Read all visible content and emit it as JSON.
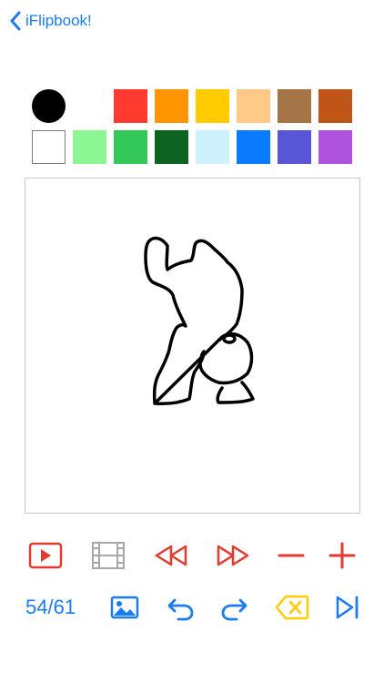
{
  "nav": {
    "back_label": "iFlipbook!"
  },
  "palette": {
    "row1": [
      {
        "name": "black",
        "hex": "#000000",
        "shape": "circle"
      },
      {
        "name": "white",
        "hex": "#ffffff",
        "shape": "square-plain"
      },
      {
        "name": "red",
        "hex": "#ff3b30",
        "shape": "square"
      },
      {
        "name": "orange",
        "hex": "#ff9500",
        "shape": "square"
      },
      {
        "name": "yellow",
        "hex": "#ffcc00",
        "shape": "square"
      },
      {
        "name": "peach",
        "hex": "#ffc987",
        "shape": "square"
      },
      {
        "name": "tan-brown",
        "hex": "#a67547",
        "shape": "square"
      },
      {
        "name": "rust",
        "hex": "#bf5516",
        "shape": "square"
      }
    ],
    "row2": [
      {
        "name": "white-outlined",
        "hex": "#ffffff",
        "shape": "square-outlined"
      },
      {
        "name": "light-green",
        "hex": "#8cf792",
        "shape": "square"
      },
      {
        "name": "green",
        "hex": "#34c759",
        "shape": "square"
      },
      {
        "name": "dark-green",
        "hex": "#0d6420",
        "shape": "square"
      },
      {
        "name": "light-cyan",
        "hex": "#cdf2fd",
        "shape": "square"
      },
      {
        "name": "blue",
        "hex": "#0a7aff",
        "shape": "square"
      },
      {
        "name": "indigo",
        "hex": "#5856d6",
        "shape": "square"
      },
      {
        "name": "purple",
        "hex": "#af52de",
        "shape": "square"
      }
    ]
  },
  "toolbar_row1": [
    {
      "name": "play-button",
      "icon": "play-icon",
      "color": "#e53a2f"
    },
    {
      "name": "filmstrip-button",
      "icon": "film-strip-icon",
      "color": "#a8a8a8"
    },
    {
      "name": "rewind-button",
      "icon": "rewind-icon",
      "color": "#e53a2f"
    },
    {
      "name": "fast-forward-button",
      "icon": "fast-forward-icon",
      "color": "#e53a2f"
    },
    {
      "name": "remove-frame-button",
      "icon": "minus-icon",
      "color": "#e53a2f"
    },
    {
      "name": "add-frame-button",
      "icon": "plus-icon",
      "color": "#e53a2f"
    }
  ],
  "toolbar_row2": {
    "frame_counter": "54/61",
    "buttons": [
      {
        "name": "image-button",
        "icon": "image-icon",
        "color": "#1a7cf0"
      },
      {
        "name": "undo-button",
        "icon": "undo-icon",
        "color": "#1a7cf0"
      },
      {
        "name": "redo-button",
        "icon": "redo-icon",
        "color": "#1a7cf0"
      },
      {
        "name": "clear-button",
        "icon": "backspace-x-icon",
        "color": "#ffcc00"
      },
      {
        "name": "last-frame-button",
        "icon": "skip-to-end-icon",
        "color": "#1a7cf0"
      }
    ]
  },
  "colors": {
    "accent_blue": "#1a7cf0",
    "accent_red": "#e53a2f",
    "canvas_border": "#c9c9c9",
    "stroke": "#000000"
  }
}
